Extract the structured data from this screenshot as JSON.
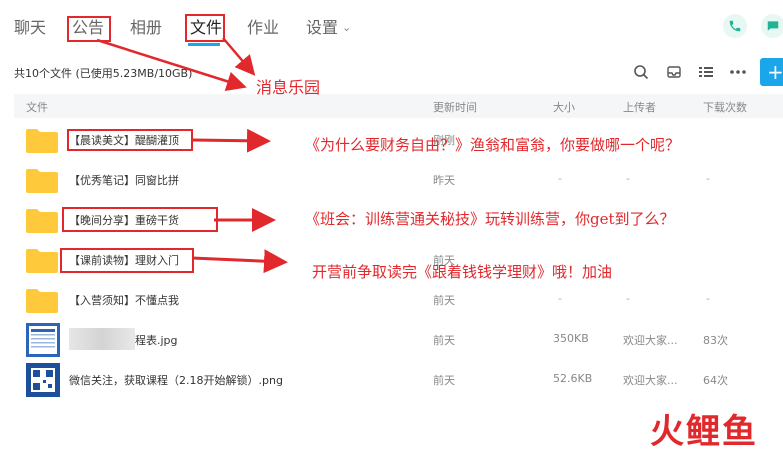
{
  "tabs": [
    {
      "label": "聊天"
    },
    {
      "label": "公告"
    },
    {
      "label": "相册"
    },
    {
      "label": "文件"
    },
    {
      "label": "作业"
    },
    {
      "label": "设置"
    }
  ],
  "toolbar": {
    "summary": "共10个文件 (已使用5.23MB/10GB)",
    "plus_label": "+"
  },
  "table": {
    "headers": {
      "name": "文件",
      "updated": "更新时间",
      "size": "大小",
      "uploader": "上传者",
      "downloads": "下载次数"
    },
    "rows": [
      {
        "name_prefix": "【晨读美文】",
        "name_rest": "醍醐灌顶",
        "updated": "刚刚",
        "size": "",
        "uploader": "",
        "downloads": ""
      },
      {
        "name_prefix": "【优秀笔记】",
        "name_rest": "同窗比拼",
        "updated": "昨天",
        "size": "-",
        "uploader": "-",
        "downloads": "-"
      },
      {
        "name_prefix": "【晚间分享】",
        "name_rest": "重磅干货",
        "updated": "",
        "size": "",
        "uploader": "",
        "downloads": ""
      },
      {
        "name_prefix": "【课前读物】",
        "name_rest": "理财入门",
        "updated": "前天",
        "size": "",
        "uploader": "",
        "downloads": ""
      },
      {
        "name_prefix": "【入营须知】",
        "name_rest": "不懂点我",
        "updated": "前天",
        "size": "-",
        "uploader": "-",
        "downloads": "-"
      },
      {
        "name": "程表.jpg",
        "updated": "前天",
        "size": "350KB",
        "uploader": "欢迎大家...",
        "downloads": "83次"
      },
      {
        "name": "微信关注，获取课程（2.18开始解锁）.png",
        "updated": "前天",
        "size": "52.6KB",
        "uploader": "欢迎大家...",
        "downloads": "64次"
      }
    ]
  },
  "annotations": {
    "announcement": "消息乐园",
    "row1": "《为什么要财务自由？》渔翁和富翁，你要做哪一个呢？",
    "row3": "《班会：训练营通关秘技》玩转训练营，你get到了么？",
    "row4": "开营前争取读完《跟着钱钱学理财》哦！加油"
  },
  "watermark": "火鲤鱼",
  "colors": {
    "accent": "#1aa6e8",
    "annotation": "#e1282c",
    "folder": "#ffc93c",
    "phone_icon": "#21b394"
  },
  "icons": [
    "phone-icon",
    "chat-icon",
    "search-icon",
    "inbox-icon",
    "list-view-icon",
    "more-icon",
    "plus-icon",
    "folder-icon",
    "chevron-down-icon"
  ]
}
